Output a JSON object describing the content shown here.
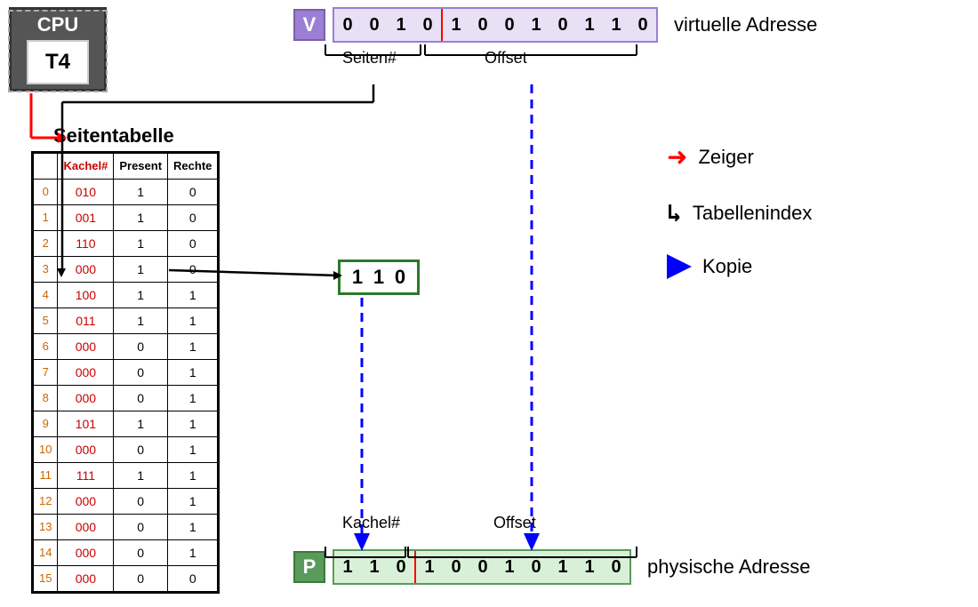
{
  "cpu": {
    "label": "CPU",
    "process": "T4"
  },
  "virtual_address": {
    "badge": "V",
    "bits": [
      "0",
      "0",
      "1",
      "0",
      "1",
      "0",
      "0",
      "1",
      "0",
      "1",
      "1",
      "0"
    ],
    "page_bits": [
      "0",
      "0",
      "1",
      "0"
    ],
    "offset_bits": [
      "1",
      "0",
      "0",
      "1",
      "0",
      "1",
      "1",
      "0"
    ],
    "separator_after": 4,
    "label": "virtuelle Adresse",
    "sublabel_seiten": "Seiten#",
    "sublabel_offset": "Offset"
  },
  "seitentabelle": {
    "title": "Seitentabelle",
    "headers": [
      "Kachel#",
      "Present",
      "Rechte"
    ],
    "rows": [
      {
        "idx": "0",
        "kachel": "010",
        "present": "1",
        "rechte": "0"
      },
      {
        "idx": "1",
        "kachel": "001",
        "present": "1",
        "rechte": "0"
      },
      {
        "idx": "2",
        "kachel": "110",
        "present": "1",
        "rechte": "0"
      },
      {
        "idx": "3",
        "kachel": "000",
        "present": "1",
        "rechte": "0"
      },
      {
        "idx": "4",
        "kachel": "100",
        "present": "1",
        "rechte": "1"
      },
      {
        "idx": "5",
        "kachel": "011",
        "present": "1",
        "rechte": "1"
      },
      {
        "idx": "6",
        "kachel": "000",
        "present": "0",
        "rechte": "1"
      },
      {
        "idx": "7",
        "kachel": "000",
        "present": "0",
        "rechte": "1"
      },
      {
        "idx": "8",
        "kachel": "000",
        "present": "0",
        "rechte": "1"
      },
      {
        "idx": "9",
        "kachel": "101",
        "present": "1",
        "rechte": "1"
      },
      {
        "idx": "10",
        "kachel": "000",
        "present": "0",
        "rechte": "1"
      },
      {
        "idx": "11",
        "kachel": "111",
        "present": "1",
        "rechte": "1"
      },
      {
        "idx": "12",
        "kachel": "000",
        "present": "0",
        "rechte": "1"
      },
      {
        "idx": "13",
        "kachel": "000",
        "present": "0",
        "rechte": "1"
      },
      {
        "idx": "14",
        "kachel": "000",
        "present": "0",
        "rechte": "1"
      },
      {
        "idx": "15",
        "kachel": "000",
        "present": "0",
        "rechte": "0"
      }
    ]
  },
  "kachel_result": {
    "bits": [
      "1",
      "1",
      "0"
    ]
  },
  "physical_address": {
    "badge": "P",
    "bits": [
      "1",
      "1",
      "0",
      "1",
      "0",
      "0",
      "1",
      "0",
      "1",
      "1",
      "0"
    ],
    "label": "physische Adresse",
    "sublabel_kachel": "Kachel#",
    "sublabel_offset": "Offset"
  },
  "legend": {
    "zeiger_label": "Zeiger",
    "tabellenindex_label": "Tabellenindex",
    "kopie_label": "Kopie"
  }
}
